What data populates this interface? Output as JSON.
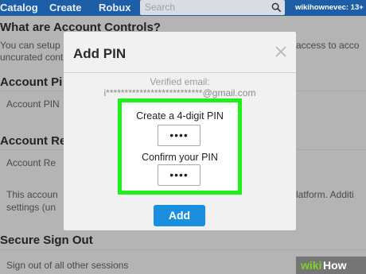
{
  "nav": {
    "links": [
      "Catalog",
      "Create",
      "Robux"
    ],
    "search_placeholder": "Search",
    "username": "wikihownevec: 13+"
  },
  "background": {
    "title": "What are Account Controls?",
    "intro_line1": "You can setup",
    "intro_line1_right": "access to acco",
    "intro_line2": "uncurated cont",
    "section1_heading": "Account Pi",
    "section1_row": "Account PIN",
    "section2_heading": "Account Re",
    "section2_row": "Account Re",
    "section2_text1": "This accoun",
    "section2_text1_right": "latform. Additi",
    "section2_text2": "settings (un",
    "section3_heading": "Secure Sign Out",
    "section3_row": "Sign out of all other sessions"
  },
  "modal": {
    "title": "Add PIN",
    "verified_label": "Verified email:",
    "verified_email": "i**************************@gmail.com",
    "create_label": "Create a 4-digit PIN",
    "create_value": "••••",
    "confirm_label": "Confirm your PIN",
    "confirm_value": "••••",
    "add_label": "Add"
  },
  "watermark": {
    "wiki": "wiki",
    "how": "How"
  },
  "colors": {
    "topbar": "#1e5ea6",
    "highlight": "#1ef01a",
    "add_button": "#1a8fe0"
  }
}
